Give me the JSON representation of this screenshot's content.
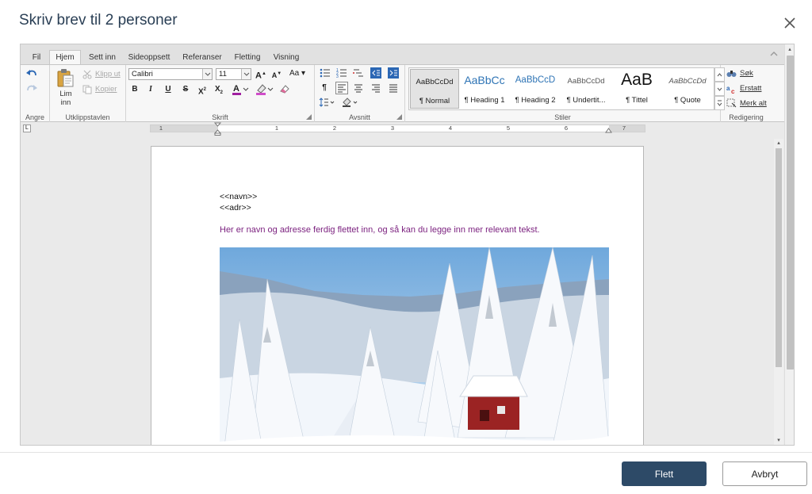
{
  "dialog": {
    "title": "Skriv brev til 2 personer",
    "close_icon": "close-icon"
  },
  "ribbon": {
    "tabs": [
      {
        "label": "Fil",
        "active": false
      },
      {
        "label": "Hjem",
        "active": true
      },
      {
        "label": "Sett inn",
        "active": false
      },
      {
        "label": "Sideoppsett",
        "active": false
      },
      {
        "label": "Referanser",
        "active": false
      },
      {
        "label": "Fletting",
        "active": false
      },
      {
        "label": "Visning",
        "active": false
      }
    ],
    "groups": {
      "undo": {
        "label": "Angre"
      },
      "clipboard": {
        "label": "Utklippstavlen",
        "paste_label_1": "Lim",
        "paste_label_2": "inn",
        "cut_label": "Klipp ut",
        "copy_label": "Kopier"
      },
      "font": {
        "label": "Skrift",
        "font_name": "Calibri",
        "font_size": "11",
        "case_label": "Aa"
      },
      "paragraph": {
        "label": "Avsnitt"
      },
      "styles": {
        "label": "Stiler",
        "items": [
          {
            "preview": "AaBbCcDd",
            "name": "¶ Normal",
            "selected": true
          },
          {
            "preview": "AaBbCc",
            "name": "¶ Heading 1",
            "selected": false
          },
          {
            "preview": "AaBbCcD",
            "name": "¶ Heading 2",
            "selected": false
          },
          {
            "preview": "AaBbCcDd",
            "name": "¶ Undertit...",
            "selected": false
          },
          {
            "preview": "AaB",
            "name": "¶ Tittel",
            "selected": false
          },
          {
            "preview": "AaBbCcDd",
            "name": "¶ Quote",
            "selected": false
          }
        ]
      },
      "editing": {
        "label": "Redigering",
        "search_label": "Søk",
        "replace_label": "Erstatt",
        "select_all_label": "Merk alt"
      }
    }
  },
  "ruler": {
    "numbers": [
      "1",
      "1",
      "2",
      "3",
      "4",
      "5",
      "6",
      "7"
    ],
    "tab_selector": "L"
  },
  "document": {
    "merge_field_name": "<<navn>>",
    "merge_field_address": "<<adr>>",
    "body_text": "Her er navn og adresse ferdig flettet inn, og så kan du legge inn mer relevant tekst.",
    "body_color": "#7a1f7e",
    "image": "snowy-forest-with-red-cabin"
  },
  "footer": {
    "primary_label": "Flett",
    "secondary_label": "Avbryt",
    "primary_color": "#2d4a67"
  }
}
